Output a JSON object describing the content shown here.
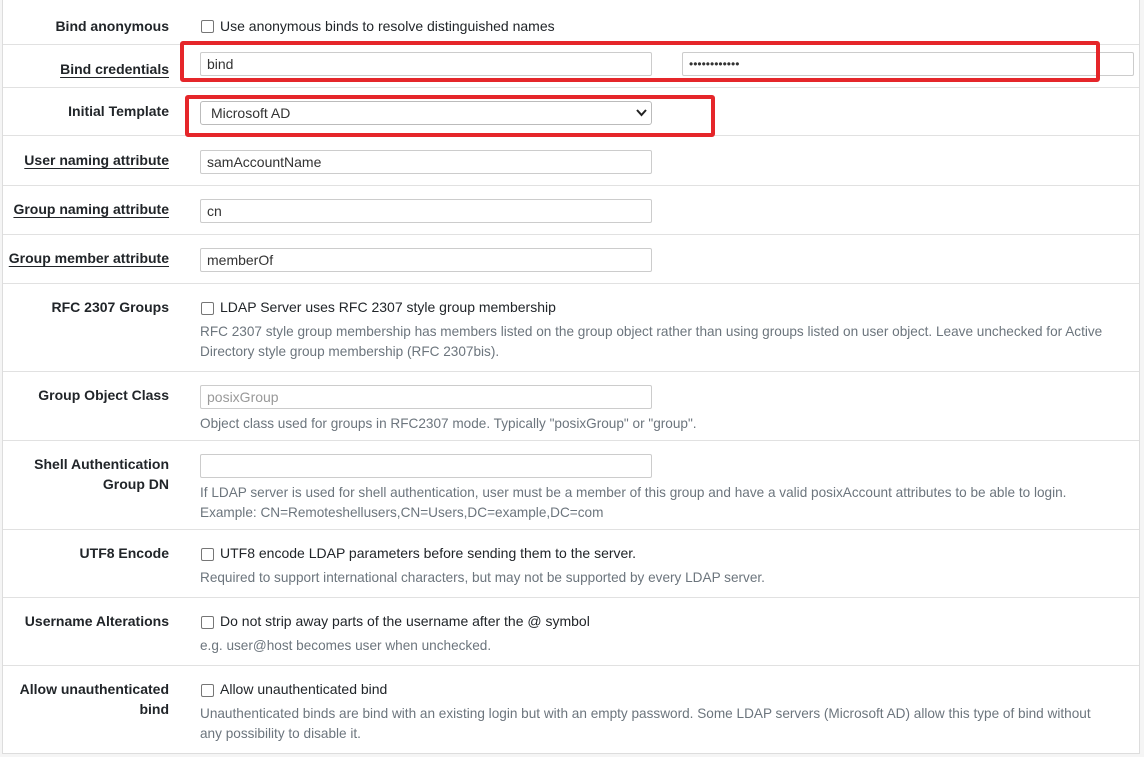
{
  "rows": {
    "bind_anonymous": {
      "label": "Bind anonymous",
      "checkbox_label": "Use anonymous binds to resolve distinguished names"
    },
    "bind_credentials": {
      "label": "Bind credentials",
      "username_value": "bind",
      "password_value": "••••••••••••"
    },
    "initial_template": {
      "label": "Initial Template",
      "selected": "Microsoft AD"
    },
    "user_naming": {
      "label": "User naming attribute",
      "value": "samAccountName"
    },
    "group_naming": {
      "label": "Group naming attribute",
      "value": "cn"
    },
    "group_member": {
      "label": "Group member attribute",
      "value": "memberOf"
    },
    "rfc2307": {
      "label": "RFC 2307 Groups",
      "checkbox_label": "LDAP Server uses RFC 2307 style group membership",
      "help_line1": "RFC 2307 style group membership has members listed on the group object rather than using groups listed on user object. Leave unchecked for Active",
      "help_line2": "Directory style group membership (RFC 2307bis)."
    },
    "group_object_class": {
      "label": "Group Object Class",
      "placeholder": "posixGroup",
      "help": "Object class used for groups in RFC2307 mode. Typically \"posixGroup\" or \"group\"."
    },
    "shell_auth": {
      "label_line1": "Shell Authentication",
      "label_line2": "Group DN",
      "value": "",
      "help_line1": "If LDAP server is used for shell authentication, user must be a member of this group and have a valid posixAccount attributes to be able to login.",
      "help_line2": "Example: CN=Remoteshellusers,CN=Users,DC=example,DC=com"
    },
    "utf8": {
      "label": "UTF8 Encode",
      "checkbox_label": "UTF8 encode LDAP parameters before sending them to the server.",
      "help": "Required to support international characters, but may not be supported by every LDAP server."
    },
    "username_alterations": {
      "label": "Username Alterations",
      "checkbox_label": "Do not strip away parts of the username after the @ symbol",
      "help": "e.g. user@host becomes user when unchecked."
    },
    "allow_unauth": {
      "label_line1": "Allow unauthenticated",
      "label_line2": "bind",
      "checkbox_label": "Allow unauthenticated bind",
      "help_line1": "Unauthenticated binds are bind with an existing login but with an empty password. Some LDAP servers (Microsoft AD) allow this type of bind without",
      "help_line2": "any possibility to disable it."
    }
  },
  "colors": {
    "highlight": "#e5262a",
    "help_text": "#6c757d"
  },
  "icons": {
    "select_arrow": "chevron-down-icon"
  }
}
